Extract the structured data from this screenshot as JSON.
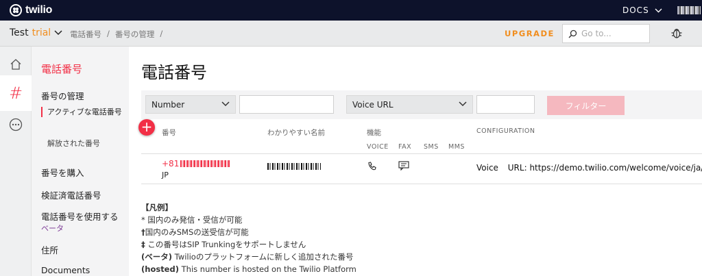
{
  "topbar": {
    "brand": "twilio",
    "docs_label": "DOCS"
  },
  "subbar": {
    "account_name": "Test",
    "account_type": "trial",
    "breadcrumbs": [
      "電話番号",
      "/",
      "番号の管理",
      "/"
    ],
    "upgrade_label": "UPGRADE",
    "search_placeholder": "Go to..."
  },
  "sidebar": {
    "title": "電話番号",
    "section": "番号の管理",
    "active_item": "アクティブな電話番号",
    "released_item": "解放された番号",
    "buy": "番号を購入",
    "verified": "検証済電話番号",
    "use_numbers": "電話番号を使用する",
    "beta": "ベータ",
    "address": "住所",
    "documents": "Documents"
  },
  "main": {
    "page_title": "電話番号",
    "filter": {
      "field1": "Number",
      "field2": "Voice URL",
      "button": "フィルター"
    },
    "table": {
      "headers": {
        "number": "番号",
        "friendly_name": "わかりやすい名前",
        "capabilities": "機能",
        "configuration": "CONFIGURATION",
        "voice": "VOICE",
        "fax": "FAX",
        "sms": "SMS",
        "mms": "MMS"
      },
      "rows": [
        {
          "number_prefix": "+81",
          "country": "JP",
          "config_type": "Voice",
          "config_label": "URL:",
          "config_url": "https://demo.twilio.com/welcome/voice/ja/"
        }
      ]
    },
    "legend": {
      "title": "【凡例】",
      "line1": "* 国内のみ発信・受信が可能",
      "line2_mark": "†",
      "line2": "国内のみSMSの送受信が可能",
      "line3_mark": "‡",
      "line3": "この番号はSIP Trunkingをサポートしません",
      "line4_mark": "(ベータ)",
      "line4": "Twilioのプラットフォームに新しく追加された番号",
      "line5_mark": "(hosted)",
      "line5": "This number is hosted on the Twilio Platform"
    }
  }
}
